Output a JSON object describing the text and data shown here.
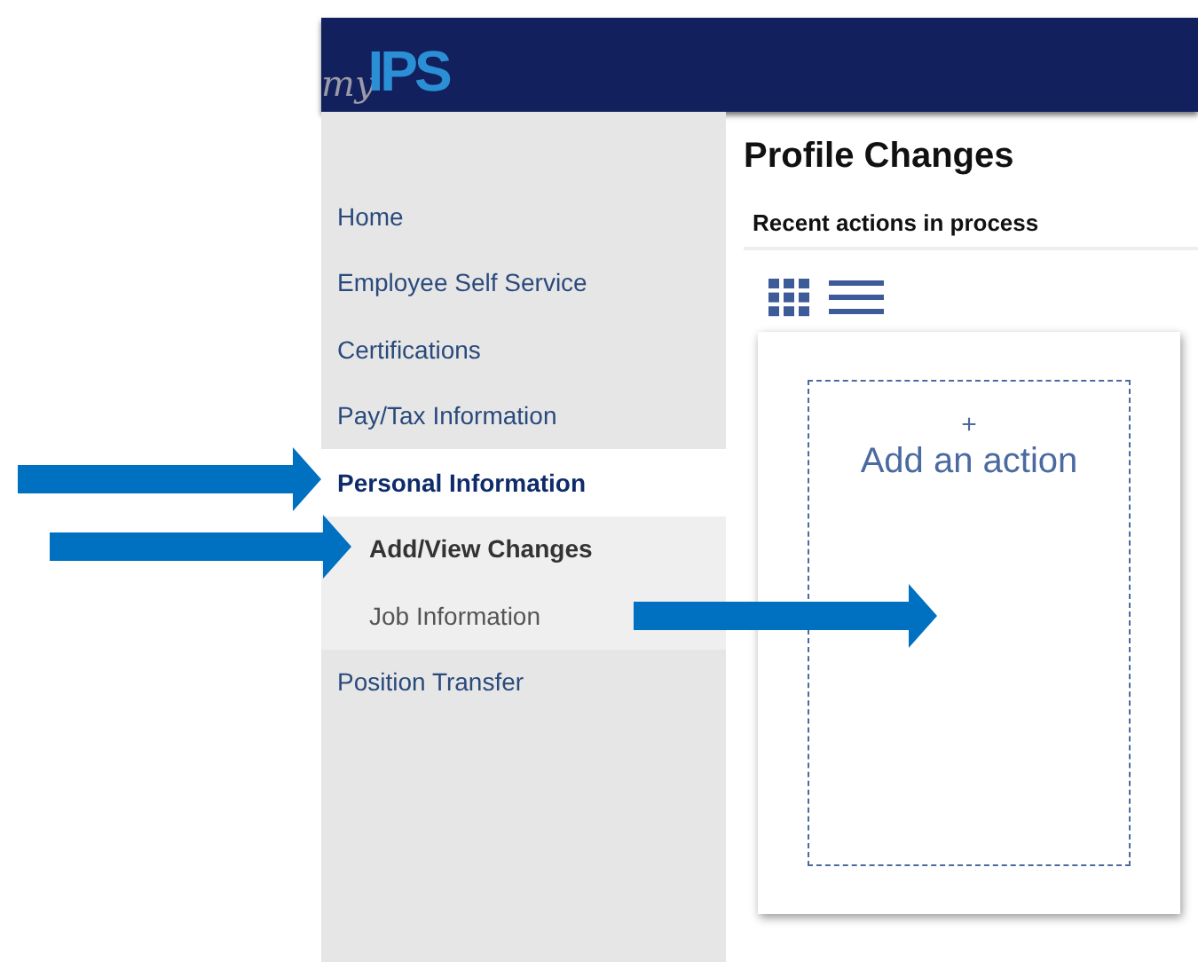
{
  "header": {
    "logo_prefix": "my",
    "logo_main": "IPS"
  },
  "sidebar": {
    "items": [
      {
        "label": "Home",
        "selected": false
      },
      {
        "label": "Employee Self Service",
        "selected": false
      },
      {
        "label": "Certifications",
        "selected": false
      },
      {
        "label": "Pay/Tax Information",
        "selected": false
      },
      {
        "label": "Personal Information",
        "selected": true,
        "children": [
          {
            "label": "Add/View Changes",
            "selected": true
          },
          {
            "label": "Job Information",
            "selected": false
          }
        ]
      },
      {
        "label": "Position Transfer",
        "selected": false
      }
    ]
  },
  "main": {
    "title": "Profile Changes",
    "section": "Recent actions in process",
    "add_card": {
      "plus": "+",
      "label": "Add an action"
    }
  },
  "annotations": [
    {
      "kind": "arrow"
    },
    {
      "kind": "arrow"
    },
    {
      "kind": "arrow"
    }
  ]
}
